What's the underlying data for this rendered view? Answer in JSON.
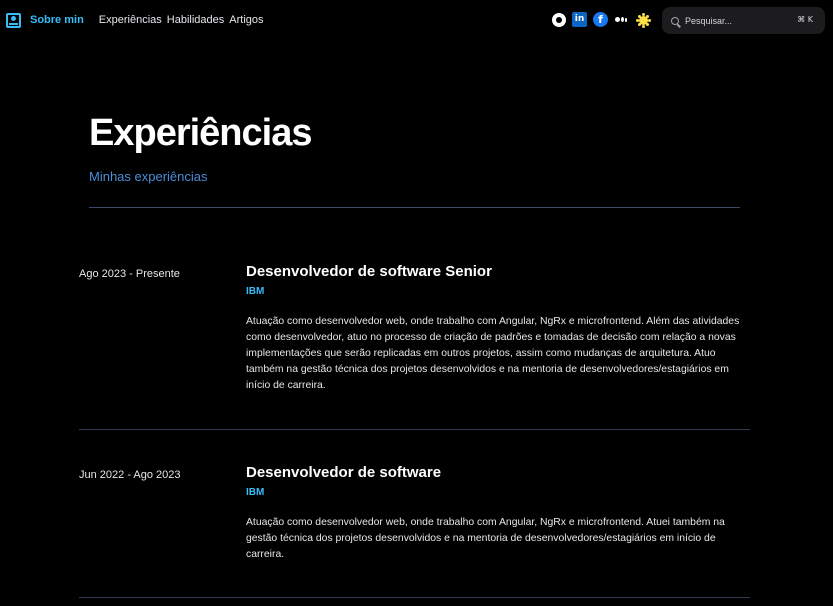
{
  "header": {
    "brand_label": "Sobre min",
    "nav": [
      "Experiências",
      "Habilidades",
      "Artigos"
    ],
    "social": [
      "github-icon",
      "linkedin-icon",
      "facebook-icon",
      "medium-icon"
    ],
    "theme_icon": "sun-icon",
    "search": {
      "placeholder": "Pesquisar...",
      "shortcut": "⌘ K"
    }
  },
  "page": {
    "title": "Experiências",
    "subtitle": "Minhas experiências"
  },
  "experiences": [
    {
      "date": "Ago 2023 - Presente",
      "role": "Desenvolvedor de software Senior",
      "company": "IBM",
      "description": "Atuação como desenvolvedor web, onde trabalho com Angular, NgRx e microfrontend. Além das atividades como desenvolvedor, atuo no processo de criação de padrões e tomadas de decisão com relação a novas implementações que serão replicadas em outros projetos, assim como mudanças de arquitetura. Atuo também na gestão técnica dos projetos desenvolvidos e na mentoria de desenvolvedores/estagiários em início de carreira."
    },
    {
      "date": "Jun 2022 - Ago 2023",
      "role": "Desenvolvedor de software",
      "company": "IBM",
      "description": "Atuação como desenvolvedor web, onde trabalho com Angular, NgRx e microfrontend. Atuei também na gestão técnica dos projetos desenvolvidos e na mentoria de desenvolvedores/estagiários em início de carreira."
    }
  ],
  "colors": {
    "accent": "#38bdf8",
    "subtitle": "#4c8dd8",
    "background": "#000000"
  }
}
